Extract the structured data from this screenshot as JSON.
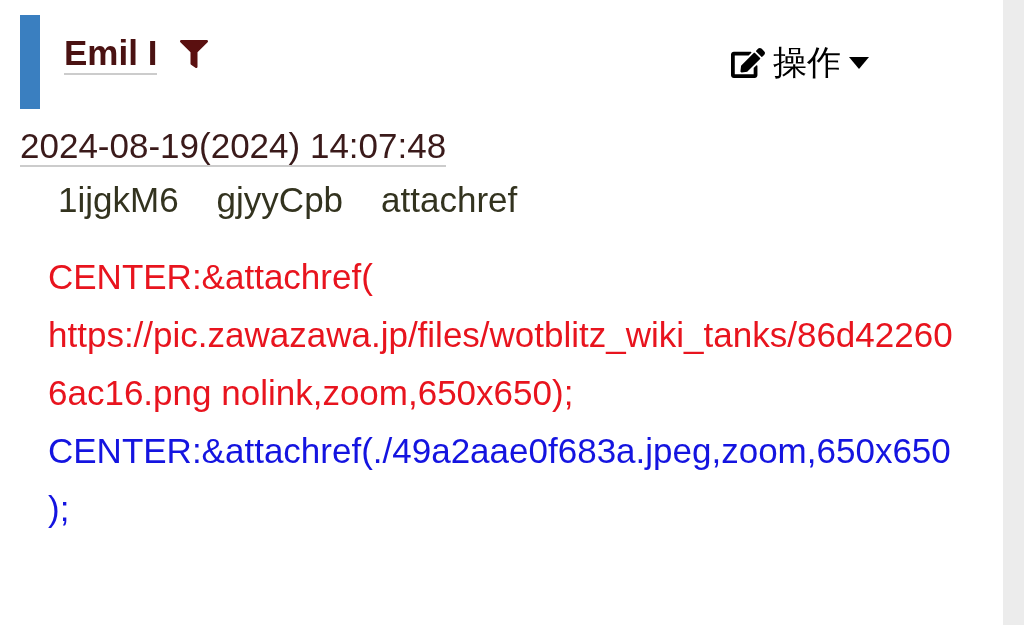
{
  "header": {
    "name": "Emil I",
    "menu": "操作"
  },
  "timestamp": "2024-08-19(2024) 14:07:48",
  "tags": [
    "1ijgkM6",
    "gjyyCpb",
    "attachref"
  ],
  "lines": [
    {
      "text": "CENTER:&attachref( https://pic.zawazawa.jp/files/wotblitz_wiki_tanks/86d422606ac16.png nolink,zoom,650x650);",
      "color": "#e8141e"
    },
    {
      "text": "CENTER:&attachref(./49a2aae0f683a.jpeg,zoom,650x650);",
      "color": "#1414e0"
    }
  ]
}
